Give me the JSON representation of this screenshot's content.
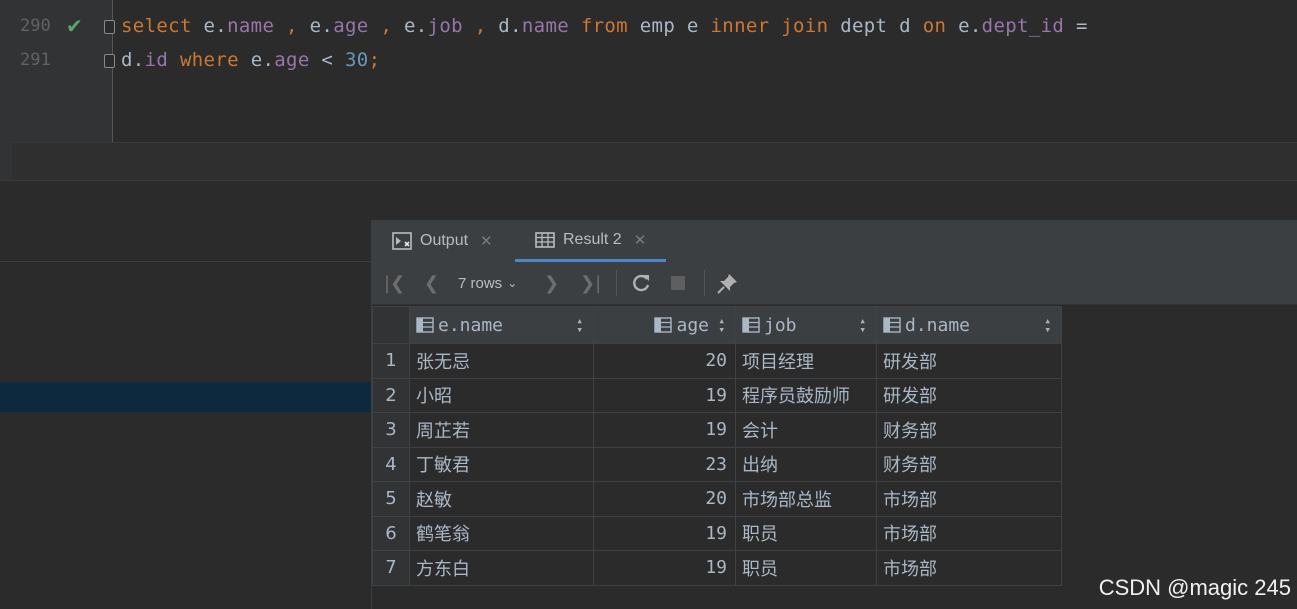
{
  "editor": {
    "lines": [
      {
        "number": "290",
        "status": "check-icon"
      },
      {
        "number": "291"
      }
    ],
    "sql_line1": {
      "t1": "select",
      "t2": " e.",
      "t3": "name",
      "t4": " , ",
      "t5": "e.",
      "t6": "age",
      "t7": " , ",
      "t8": "e.",
      "t9": "job",
      "t10": " , ",
      "t11": "d.",
      "t12": "name",
      "t13": " from ",
      "t14": "emp e ",
      "t15": "inner join ",
      "t16": "dept d ",
      "t17": "on ",
      "t18": "e.",
      "t19": "dept_id",
      "t20": " ="
    },
    "sql_line2": {
      "t1": "d.",
      "t2": "id",
      "t3": " where ",
      "t4": "e.",
      "t5": "age",
      "t6": " < ",
      "t7": "30",
      "t8": ";"
    }
  },
  "results": {
    "tabs": [
      {
        "label": "Output",
        "icon": "console-icon"
      },
      {
        "label": "Result 2",
        "icon": "table-icon",
        "active": true
      }
    ],
    "toolbar": {
      "rows_label": "7 rows",
      "icons": [
        "first-page-icon",
        "prev-page-icon",
        "next-page-icon",
        "last-page-icon",
        "refresh-icon",
        "stop-icon",
        "pin-icon"
      ]
    },
    "columns": [
      "e.name",
      "age",
      "job",
      "d.name"
    ],
    "rows": [
      {
        "n": "1",
        "name": "张无忌",
        "age": "20",
        "job": "项目经理",
        "dname": "研发部"
      },
      {
        "n": "2",
        "name": "小昭",
        "age": "19",
        "job": "程序员鼓励师",
        "dname": "研发部"
      },
      {
        "n": "3",
        "name": "周芷若",
        "age": "19",
        "job": "会计",
        "dname": "财务部"
      },
      {
        "n": "4",
        "name": "丁敏君",
        "age": "23",
        "job": "出纳",
        "dname": "财务部"
      },
      {
        "n": "5",
        "name": "赵敏",
        "age": "20",
        "job": "市场部总监",
        "dname": "市场部"
      },
      {
        "n": "6",
        "name": "鹤笔翁",
        "age": "19",
        "job": "职员",
        "dname": "市场部"
      },
      {
        "n": "7",
        "name": "方东白",
        "age": "19",
        "job": "职员",
        "dname": "市场部"
      }
    ]
  },
  "watermark": "CSDN @magic 245",
  "colors": {
    "keyword": "#cc7832",
    "field": "#9876aa",
    "number": "#6897bb",
    "plain": "#a9b7c6",
    "check": "#59a869",
    "selection": "#0d293e",
    "active_tab_underline": "#4a88c7"
  }
}
